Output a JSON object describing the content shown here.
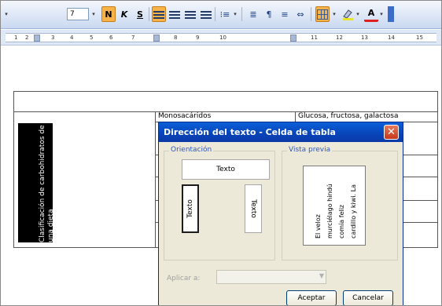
{
  "toolbar": {
    "font_size": "7",
    "buttons": [
      "N",
      "K",
      "S"
    ],
    "dropdown_glyph": "▾",
    "tool_glyphs": [
      "⁝≡",
      "≣",
      "¶",
      "≡",
      "⇔"
    ],
    "color_glyphs": [
      "A"
    ]
  },
  "ruler": {
    "numbers": [
      "1",
      "2",
      "3",
      "4",
      "5",
      "6",
      "7",
      "8",
      "9",
      "10",
      "11",
      "12",
      "13",
      "14",
      "15"
    ]
  },
  "table": {
    "row1_col2": "Monosacáridos",
    "row1_col3": "Glucosa, fructosa, galactosa",
    "rotated_cell": "Clasificación de carbohidratos de una dieta"
  },
  "dialog": {
    "title": "Dirección del texto - Celda de tabla",
    "orientation_label": "Orientación",
    "preview_label": "Vista previa",
    "option_horizontal": "Texto",
    "option_up": "Texto",
    "option_down": "Texto",
    "preview_lines": [
      "El veloz",
      "murciélago hindú",
      "comía feliz",
      "cardillo y kiwi. La"
    ],
    "apply_label": "Aplicar a:",
    "accept": "Aceptar",
    "cancel": "Cancelar"
  }
}
